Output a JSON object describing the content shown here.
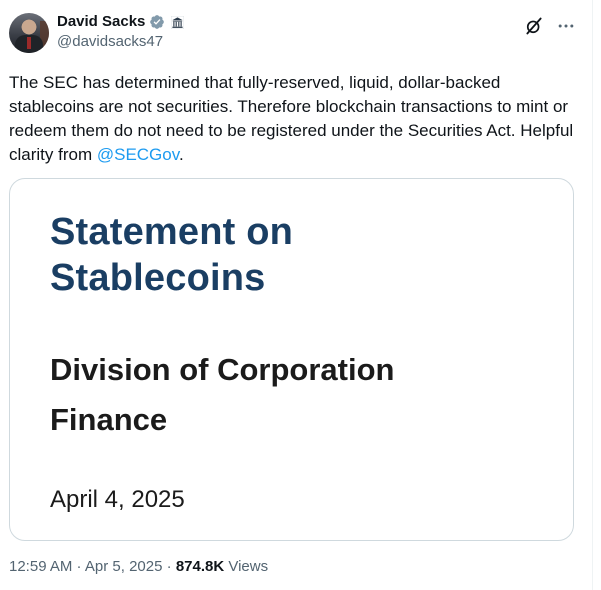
{
  "author": {
    "display_name": "David Sacks",
    "handle": "@davidsacks47"
  },
  "tweet": {
    "text_before": "The SEC has determined that fully-reserved, liquid, dollar-backed stablecoins are not securities. Therefore blockchain transactions to mint or redeem them do not need to be registered under the Securities Act. Helpful clarity from ",
    "mention": "@SECGov",
    "text_after": "."
  },
  "card": {
    "title_line1": "Statement on",
    "title_line2": "Stablecoins",
    "subtitle_line1": "Division of Corporation",
    "subtitle_line2": "Finance",
    "date": "April 4, 2025"
  },
  "meta": {
    "time": "12:59 AM",
    "sep1": " · ",
    "date": "Apr 5, 2025",
    "sep2": " · ",
    "views_count": "874.8K",
    "views_label": " Views"
  },
  "icons": {
    "verified": "verified-badge-icon",
    "affiliation": "government-building-icon",
    "grok": "grok-icon",
    "more": "more-icon"
  },
  "colors": {
    "accent": "#1d9bf0",
    "card_title": "#1a3e63",
    "secondary_text": "#536471"
  }
}
